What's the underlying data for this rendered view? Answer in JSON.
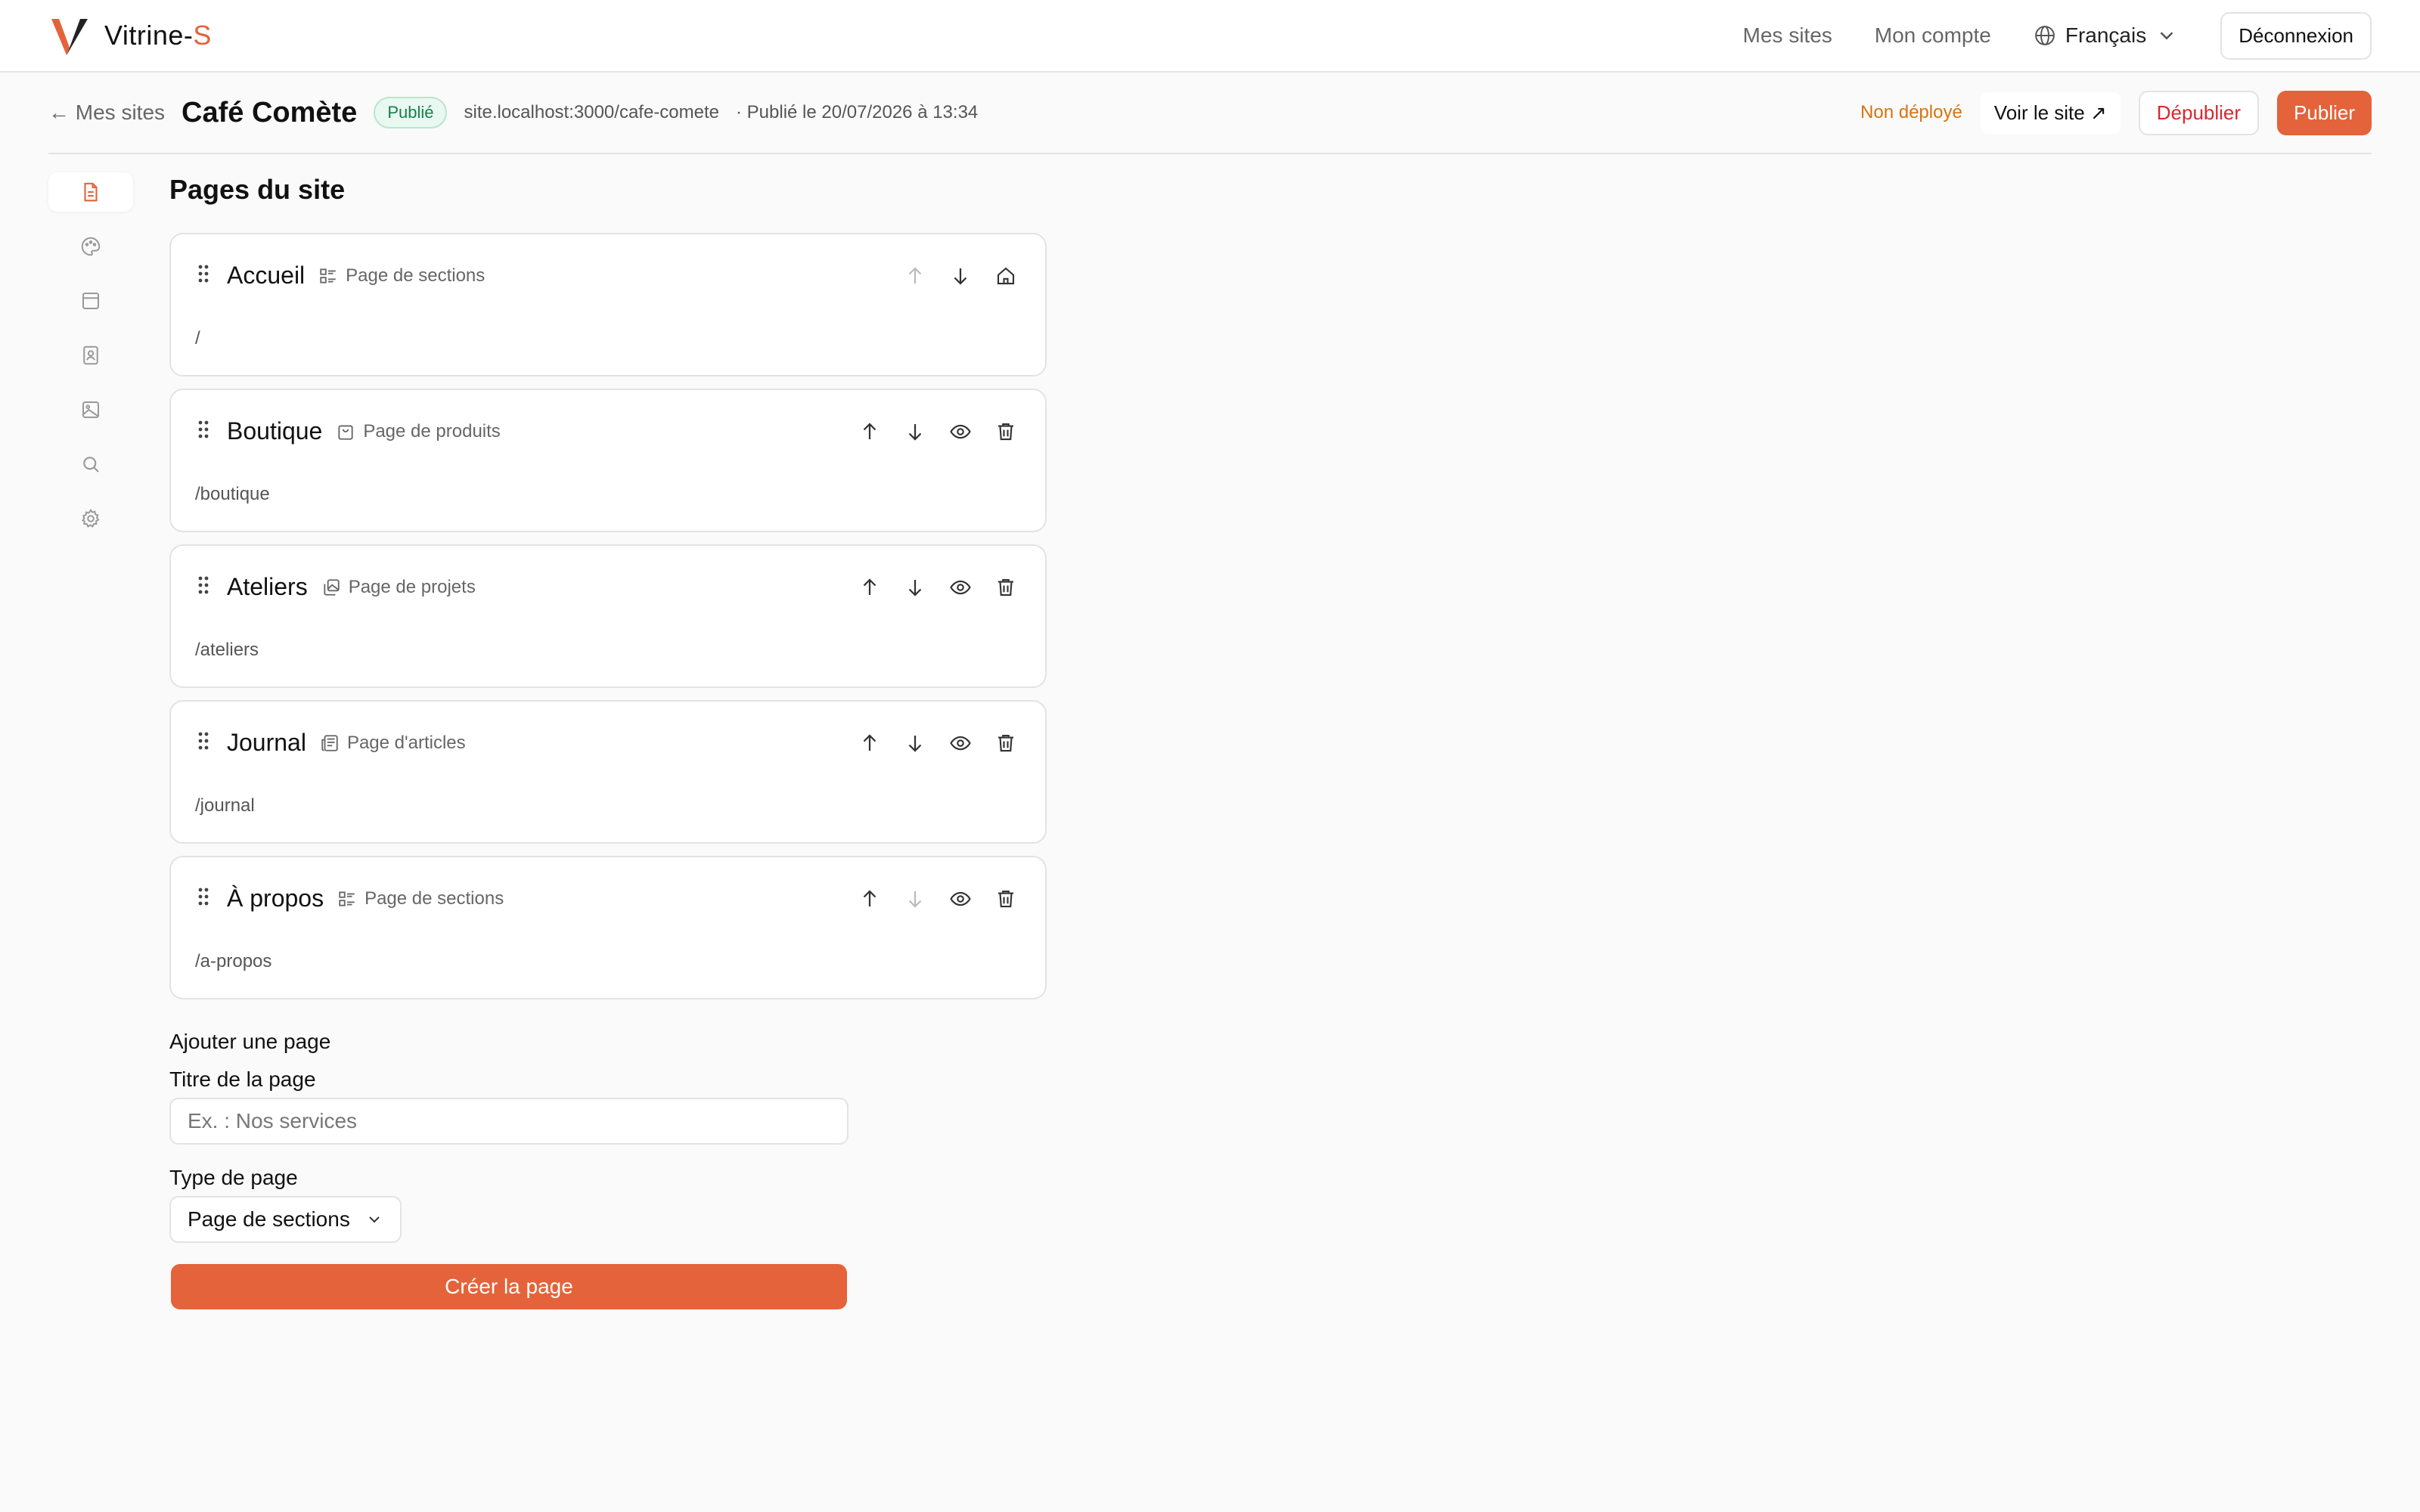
{
  "colors": {
    "accent": "#e4633a",
    "published": "#16804a",
    "danger": "#d8272f",
    "warning": "#d7740a"
  },
  "topbar": {
    "brand_name": "Vitrine-",
    "brand_suffix": "S",
    "nav": [
      "Mes sites",
      "Mon compte"
    ],
    "language": "Français",
    "logout": "Déconnexion"
  },
  "site": {
    "back": "← Mes sites",
    "title": "Café Comète",
    "status": "Publié",
    "url": "site.localhost:3000/cafe-comete",
    "published_at": "· Publié le 20/07/2026 à 13:34",
    "deploy_status": "Non déployé",
    "view_site": "Voir le site ↗",
    "unpublish": "Dépublier",
    "publish": "Publier"
  },
  "rail": [
    "pages-icon",
    "palette-icon",
    "layout-icon",
    "contact-icon",
    "image-icon",
    "search-icon",
    "settings-icon"
  ],
  "main": {
    "heading": "Pages du site",
    "pages": [
      {
        "title": "Accueil",
        "type": "Page de sections",
        "type_icon": "sections-icon",
        "slug": "/",
        "home": true,
        "up_disabled": true,
        "down_disabled": false
      },
      {
        "title": "Boutique",
        "type": "Page de produits",
        "type_icon": "bag-icon",
        "slug": "/boutique",
        "home": false,
        "up_disabled": false,
        "down_disabled": false
      },
      {
        "title": "Ateliers",
        "type": "Page de projets",
        "type_icon": "gallery-icon",
        "slug": "/ateliers",
        "home": false,
        "up_disabled": false,
        "down_disabled": false
      },
      {
        "title": "Journal",
        "type": "Page d'articles",
        "type_icon": "newspaper-icon",
        "slug": "/journal",
        "home": false,
        "up_disabled": false,
        "down_disabled": false
      },
      {
        "title": "À propos",
        "type": "Page de sections",
        "type_icon": "sections-icon",
        "slug": "/a-propos",
        "home": false,
        "up_disabled": false,
        "down_disabled": true
      }
    ]
  },
  "add_page": {
    "heading": "Ajouter une page",
    "title_label": "Titre de la page",
    "title_placeholder": "Ex. : Nos services",
    "type_label": "Type de page",
    "type_value": "Page de sections",
    "submit": "Créer la page"
  }
}
